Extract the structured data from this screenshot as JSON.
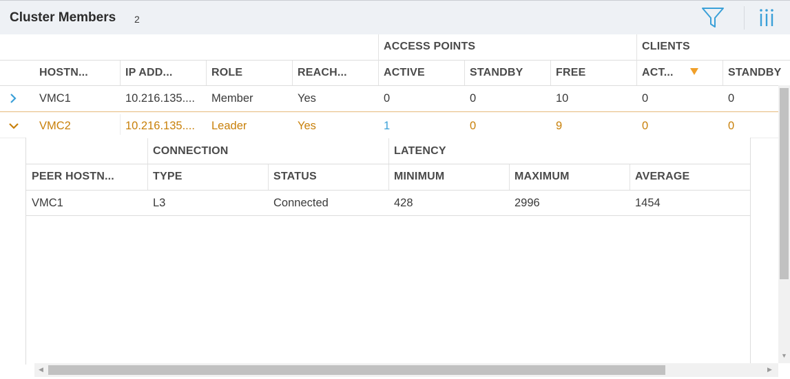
{
  "panel": {
    "title": "Cluster Members",
    "count": "2",
    "filter_icon": "filter-icon",
    "columns_icon": "column-chooser-icon",
    "accent": "#3aa0d8"
  },
  "members": {
    "group_headers": {
      "access_points": "ACCESS POINTS",
      "clients": "CLIENTS"
    },
    "columns": [
      "HOSTN...",
      "IP ADD...",
      "ROLE",
      "REACH...",
      "ACTIVE",
      "STANDBY",
      "FREE",
      "ACT...",
      "STANDBY"
    ],
    "sort": {
      "column": "ACT...",
      "direction": "descending",
      "color": "#f0a02a"
    },
    "rows": [
      {
        "hostname": "VMC1",
        "ip": "10.216.135....",
        "role": "Member",
        "reachable": "Yes",
        "ap_active": "0",
        "ap_standby": "0",
        "ap_free": "10",
        "cl_active": "0",
        "cl_standby": "0",
        "expanded": false
      },
      {
        "hostname": "VMC2",
        "ip": "10.216.135....",
        "role": "Leader",
        "reachable": "Yes",
        "ap_active": "1",
        "ap_standby": "0",
        "ap_free": "9",
        "cl_active": "0",
        "cl_standby": "0",
        "expanded": true
      }
    ],
    "selected_color": "#c8800a"
  },
  "peers": {
    "group_headers": {
      "connection": "CONNECTION",
      "latency": "LATENCY"
    },
    "columns": [
      "PEER HOSTN...",
      "TYPE",
      "STATUS",
      "MINIMUM",
      "MAXIMUM",
      "AVERAGE"
    ],
    "rows": [
      {
        "peer_hostname": "VMC1",
        "type": "L3",
        "status": "Connected",
        "minimum": "428",
        "maximum": "2996",
        "average": "1454"
      }
    ]
  }
}
